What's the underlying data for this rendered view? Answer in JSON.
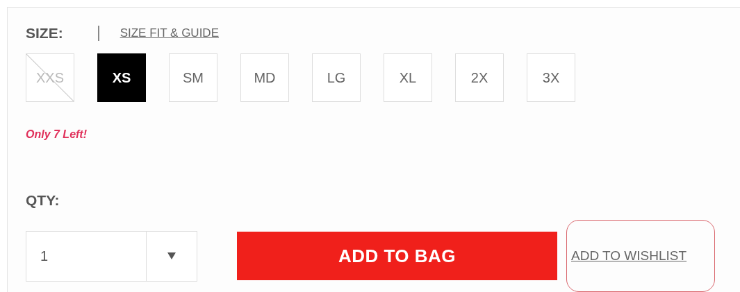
{
  "size_label": "SIZE:",
  "size_guide_link": "SIZE FIT & GUIDE",
  "sizes": [
    {
      "label": "XXS",
      "selected": false,
      "available": false
    },
    {
      "label": "XS",
      "selected": true,
      "available": true
    },
    {
      "label": "SM",
      "selected": false,
      "available": true
    },
    {
      "label": "MD",
      "selected": false,
      "available": true
    },
    {
      "label": "LG",
      "selected": false,
      "available": true
    },
    {
      "label": "XL",
      "selected": false,
      "available": true
    },
    {
      "label": "2X",
      "selected": false,
      "available": true
    },
    {
      "label": "3X",
      "selected": false,
      "available": true
    }
  ],
  "stock_note": "Only 7 Left!",
  "qty_label": "QTY:",
  "qty_select": {
    "value": "1"
  },
  "add_to_bag_button": "ADD TO BAG",
  "wishlist_link": {
    "label": "ADD TO WISHLIST",
    "highlighted": true
  }
}
